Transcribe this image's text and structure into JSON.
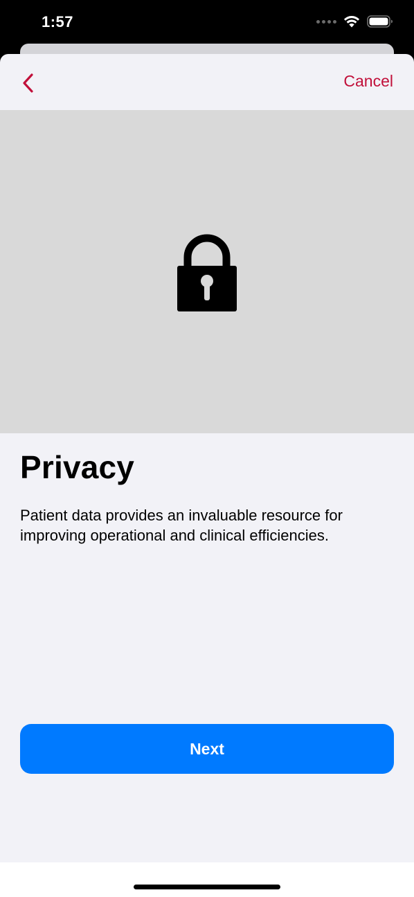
{
  "status_bar": {
    "time": "1:57",
    "icons": [
      "cellular-dots-icon",
      "wifi-icon",
      "battery-icon"
    ]
  },
  "nav": {
    "back_icon": "chevron-left-icon",
    "cancel_label": "Cancel"
  },
  "hero": {
    "icon": "lock-icon",
    "background": "#d9d9d9"
  },
  "content": {
    "title": "Privacy",
    "body": "Patient data provides an invaluable resource for improving operational and clinical efficiencies."
  },
  "actions": {
    "next_label": "Next"
  },
  "colors": {
    "accent": "#c1103a",
    "primary_button": "#007aff",
    "sheet_background": "#f2f2f7"
  }
}
